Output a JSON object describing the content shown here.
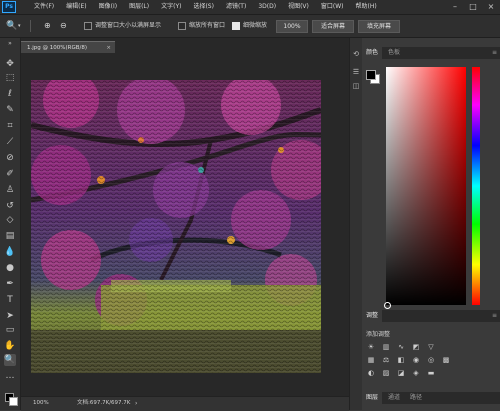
{
  "app": {
    "logo": "Ps"
  },
  "menu": [
    "文件(F)",
    "编辑(E)",
    "图像(I)",
    "图层(L)",
    "文字(Y)",
    "选择(S)",
    "滤镜(T)",
    "3D(D)",
    "视图(V)",
    "窗口(W)",
    "帮助(H)"
  ],
  "options": {
    "resize_windows_label": "调整窗口大小以满屏显示",
    "zoom_all_label": "缩放所有窗口",
    "scrubby_zoom_label": "细微缩放",
    "zoom_value": "100%",
    "fit_screen_label": "适合屏幕",
    "fill_screen_label": "填充屏幕"
  },
  "document": {
    "tab_title": "1.jpg @ 100%(RGB/8)",
    "zoom": "100%",
    "doc_size": "文档:697.7K/697.7K"
  },
  "panels": {
    "color_tab": "颜色",
    "swatches_tab": "色板",
    "adjustments_tab": "调整",
    "add_adjustment_label": "添加调整",
    "layers_tab": "图层",
    "channels_tab": "通道",
    "paths_tab": "路径"
  },
  "colors": {
    "foreground": "#000000",
    "background": "#ffffff",
    "accent": "#31a8ff"
  },
  "icons": [
    "move-icon",
    "marquee-icon",
    "lasso-icon",
    "quick-select-icon",
    "crop-icon",
    "eyedropper-icon",
    "healing-brush-icon",
    "brush-icon",
    "clone-stamp-icon",
    "history-brush-icon",
    "eraser-icon",
    "gradient-icon",
    "blur-icon",
    "dodge-icon",
    "pen-icon",
    "type-icon",
    "path-select-icon",
    "rectangle-icon",
    "hand-icon",
    "zoom-icon"
  ]
}
